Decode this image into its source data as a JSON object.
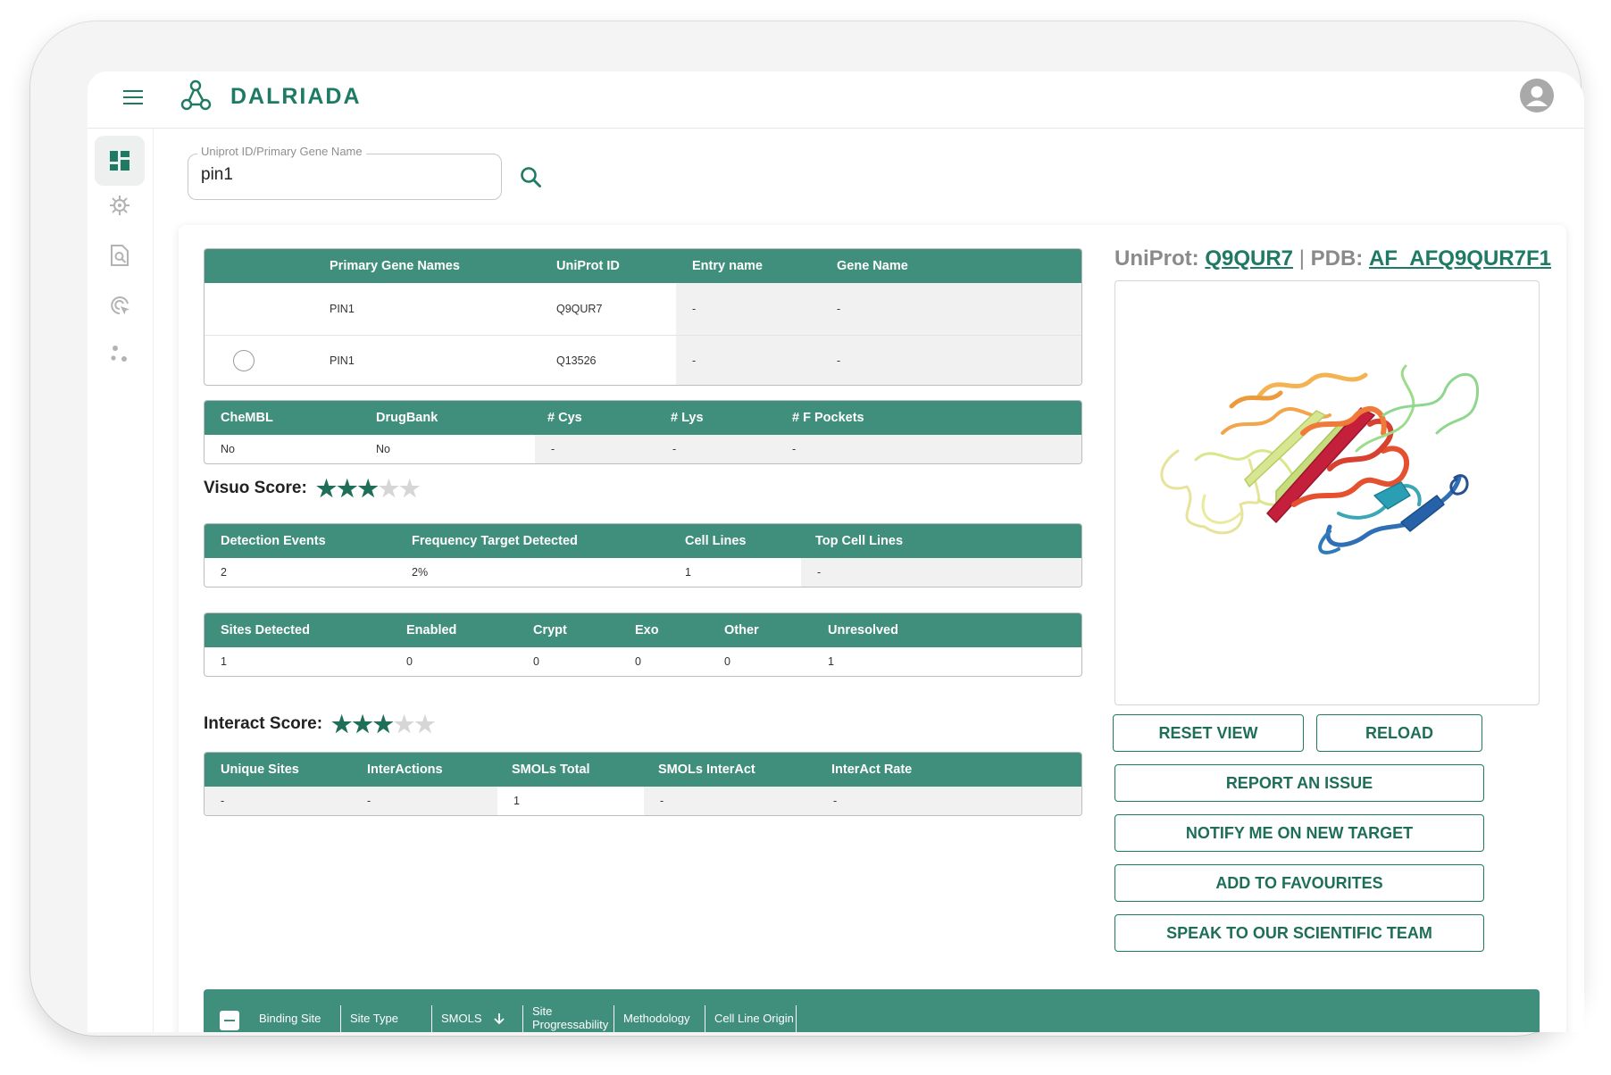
{
  "brand": {
    "name": "DALRIADA",
    "accent": "#1e7a63",
    "table_header": "#408f7c"
  },
  "nav": [
    {
      "icon": "dashboard-icon",
      "active": true
    },
    {
      "icon": "virus-icon"
    },
    {
      "icon": "document-search-icon"
    },
    {
      "icon": "target-cursor-icon"
    },
    {
      "icon": "dots-cluster-icon"
    }
  ],
  "search": {
    "label": "Uniprot ID/Primary Gene Name",
    "value": "pin1"
  },
  "gene_table": {
    "headers": [
      "Primary Gene Names",
      "UniProt ID",
      "Entry name",
      "Gene Name"
    ],
    "rows": [
      [
        "PIN1",
        "Q9QUR7",
        "-",
        "-"
      ],
      [
        "PIN1",
        "Q13526",
        "-",
        "-"
      ]
    ]
  },
  "db_table": {
    "headers": [
      "CheMBL",
      "DrugBank",
      "# Cys",
      "# Lys",
      "# F Pockets"
    ],
    "rows": [
      [
        "No",
        "No",
        "-",
        "-",
        "-"
      ]
    ]
  },
  "visuo_score": {
    "label": "Visuo Score:",
    "stars": 3,
    "max": 5
  },
  "detection_table": {
    "headers": [
      "Detection Events",
      "Frequency Target Detected",
      "Cell Lines",
      "Top Cell Lines"
    ],
    "rows": [
      [
        "2",
        "2%",
        "1",
        "-"
      ]
    ]
  },
  "sites_table": {
    "headers": [
      "Sites Detected",
      "Enabled",
      "Crypt",
      "Exo",
      "Other",
      "Unresolved"
    ],
    "rows": [
      [
        "1",
        "0",
        "0",
        "0",
        "0",
        "1"
      ]
    ]
  },
  "interact_score": {
    "label": "Interact Score:",
    "stars": 3,
    "max": 5
  },
  "interact_table": {
    "headers": [
      "Unique Sites",
      "InterActions",
      "SMOLs Total",
      "SMOLs InterAct",
      "InterAct Rate"
    ],
    "rows": [
      [
        "-",
        "-",
        "1",
        "-",
        "-"
      ]
    ]
  },
  "structure": {
    "uniprot_label": "UniProt:",
    "uniprot_id": "Q9QUR7",
    "separator": "|",
    "pdb_label": "PDB:",
    "pdb_id": "AF_AFQ9QUR7F1"
  },
  "actions": {
    "reset_view": "RESET VIEW",
    "reload": "RELOAD",
    "report_issue": "REPORT AN ISSUE",
    "notify": "NOTIFY ME ON NEW TARGET",
    "favourites": "ADD TO FAVOURITES",
    "speak": "SPEAK TO OUR SCIENTIFIC TEAM"
  },
  "binding_table": {
    "headers": [
      "Binding Site",
      "Site Type",
      "SMOLS",
      "Site Progressability",
      "Methodology",
      "Cell Line Origin"
    ]
  }
}
